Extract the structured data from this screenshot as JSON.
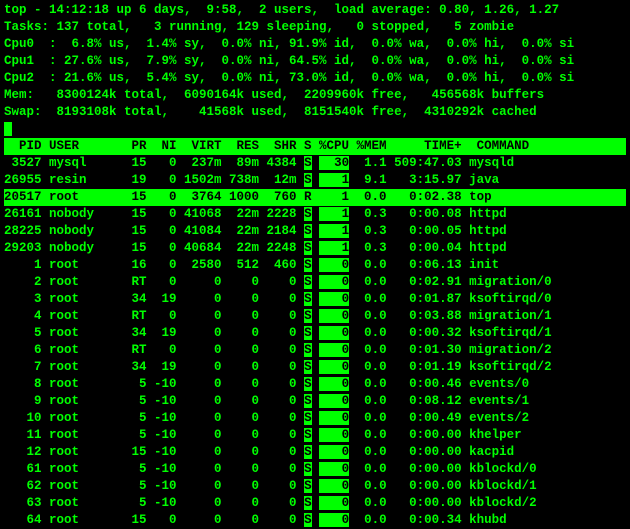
{
  "summary": {
    "l1": "top - 14:12:18 up 6 days,  9:58,  2 users,  load average: 0.80, 1.26, 1.27",
    "l2": "Tasks: 137 total,   3 running, 129 sleeping,   0 stopped,   5 zombie",
    "l3": "Cpu0  :  6.8% us,  1.4% sy,  0.0% ni, 91.9% id,  0.0% wa,  0.0% hi,  0.0% si",
    "l4": "Cpu1  : 27.6% us,  7.9% sy,  0.0% ni, 64.5% id,  0.0% wa,  0.0% hi,  0.0% si",
    "l5": "Cpu2  : 21.6% us,  5.4% sy,  0.0% ni, 73.0% id,  0.0% wa,  0.0% hi,  0.0% si",
    "l6": "Mem:   8300124k total,  6090164k used,  2209960k free,   456568k buffers",
    "l7": "Swap:  8193108k total,    41568k used,  8151540k free,  4310292k cached"
  },
  "columns": {
    "pid": "PID",
    "user": "USER",
    "pr": "PR",
    "ni": "NI",
    "virt": "VIRT",
    "res": "RES",
    "shr": "SHR",
    "s": "S",
    "cpu": "%CPU",
    "mem": "%MEM",
    "time": "TIME+",
    "command": "COMMAND"
  },
  "rows": [
    {
      "sel": false,
      "pid": "3527",
      "user": "mysql",
      "pr": "15",
      "ni": "0",
      "virt": "237m",
      "res": "89m",
      "shr": "4384",
      "s": "S",
      "cpu": "30",
      "mem": "1.1",
      "time": "509:47.03",
      "command": "mysqld"
    },
    {
      "sel": false,
      "pid": "26955",
      "user": "resin",
      "pr": "19",
      "ni": "0",
      "virt": "1502m",
      "res": "738m",
      "shr": "12m",
      "s": "S",
      "cpu": "1",
      "mem": "9.1",
      "time": "3:15.97",
      "command": "java"
    },
    {
      "sel": true,
      "pid": "20517",
      "user": "root",
      "pr": "15",
      "ni": "0",
      "virt": "3764",
      "res": "1000",
      "shr": "760",
      "s": "R",
      "cpu": "1",
      "mem": "0.0",
      "time": "0:02.38",
      "command": "top"
    },
    {
      "sel": false,
      "pid": "26161",
      "user": "nobody",
      "pr": "15",
      "ni": "0",
      "virt": "41068",
      "res": "22m",
      "shr": "2228",
      "s": "S",
      "cpu": "1",
      "mem": "0.3",
      "time": "0:00.08",
      "command": "httpd"
    },
    {
      "sel": false,
      "pid": "28225",
      "user": "nobody",
      "pr": "15",
      "ni": "0",
      "virt": "41084",
      "res": "22m",
      "shr": "2184",
      "s": "S",
      "cpu": "1",
      "mem": "0.3",
      "time": "0:00.05",
      "command": "httpd"
    },
    {
      "sel": false,
      "pid": "29203",
      "user": "nobody",
      "pr": "15",
      "ni": "0",
      "virt": "40684",
      "res": "22m",
      "shr": "2248",
      "s": "S",
      "cpu": "1",
      "mem": "0.3",
      "time": "0:00.04",
      "command": "httpd"
    },
    {
      "sel": false,
      "pid": "1",
      "user": "root",
      "pr": "16",
      "ni": "0",
      "virt": "2580",
      "res": "512",
      "shr": "460",
      "s": "S",
      "cpu": "0",
      "mem": "0.0",
      "time": "0:06.13",
      "command": "init"
    },
    {
      "sel": false,
      "pid": "2",
      "user": "root",
      "pr": "RT",
      "ni": "0",
      "virt": "0",
      "res": "0",
      "shr": "0",
      "s": "S",
      "cpu": "0",
      "mem": "0.0",
      "time": "0:02.91",
      "command": "migration/0"
    },
    {
      "sel": false,
      "pid": "3",
      "user": "root",
      "pr": "34",
      "ni": "19",
      "virt": "0",
      "res": "0",
      "shr": "0",
      "s": "S",
      "cpu": "0",
      "mem": "0.0",
      "time": "0:01.87",
      "command": "ksoftirqd/0"
    },
    {
      "sel": false,
      "pid": "4",
      "user": "root",
      "pr": "RT",
      "ni": "0",
      "virt": "0",
      "res": "0",
      "shr": "0",
      "s": "S",
      "cpu": "0",
      "mem": "0.0",
      "time": "0:03.88",
      "command": "migration/1"
    },
    {
      "sel": false,
      "pid": "5",
      "user": "root",
      "pr": "34",
      "ni": "19",
      "virt": "0",
      "res": "0",
      "shr": "0",
      "s": "S",
      "cpu": "0",
      "mem": "0.0",
      "time": "0:00.32",
      "command": "ksoftirqd/1"
    },
    {
      "sel": false,
      "pid": "6",
      "user": "root",
      "pr": "RT",
      "ni": "0",
      "virt": "0",
      "res": "0",
      "shr": "0",
      "s": "S",
      "cpu": "0",
      "mem": "0.0",
      "time": "0:01.30",
      "command": "migration/2"
    },
    {
      "sel": false,
      "pid": "7",
      "user": "root",
      "pr": "34",
      "ni": "19",
      "virt": "0",
      "res": "0",
      "shr": "0",
      "s": "S",
      "cpu": "0",
      "mem": "0.0",
      "time": "0:01.19",
      "command": "ksoftirqd/2"
    },
    {
      "sel": false,
      "pid": "8",
      "user": "root",
      "pr": "5",
      "ni": "-10",
      "virt": "0",
      "res": "0",
      "shr": "0",
      "s": "S",
      "cpu": "0",
      "mem": "0.0",
      "time": "0:00.46",
      "command": "events/0"
    },
    {
      "sel": false,
      "pid": "9",
      "user": "root",
      "pr": "5",
      "ni": "-10",
      "virt": "0",
      "res": "0",
      "shr": "0",
      "s": "S",
      "cpu": "0",
      "mem": "0.0",
      "time": "0:08.12",
      "command": "events/1"
    },
    {
      "sel": false,
      "pid": "10",
      "user": "root",
      "pr": "5",
      "ni": "-10",
      "virt": "0",
      "res": "0",
      "shr": "0",
      "s": "S",
      "cpu": "0",
      "mem": "0.0",
      "time": "0:00.49",
      "command": "events/2"
    },
    {
      "sel": false,
      "pid": "11",
      "user": "root",
      "pr": "5",
      "ni": "-10",
      "virt": "0",
      "res": "0",
      "shr": "0",
      "s": "S",
      "cpu": "0",
      "mem": "0.0",
      "time": "0:00.00",
      "command": "khelper"
    },
    {
      "sel": false,
      "pid": "12",
      "user": "root",
      "pr": "15",
      "ni": "-10",
      "virt": "0",
      "res": "0",
      "shr": "0",
      "s": "S",
      "cpu": "0",
      "mem": "0.0",
      "time": "0:00.00",
      "command": "kacpid"
    },
    {
      "sel": false,
      "pid": "61",
      "user": "root",
      "pr": "5",
      "ni": "-10",
      "virt": "0",
      "res": "0",
      "shr": "0",
      "s": "S",
      "cpu": "0",
      "mem": "0.0",
      "time": "0:00.00",
      "command": "kblockd/0"
    },
    {
      "sel": false,
      "pid": "62",
      "user": "root",
      "pr": "5",
      "ni": "-10",
      "virt": "0",
      "res": "0",
      "shr": "0",
      "s": "S",
      "cpu": "0",
      "mem": "0.0",
      "time": "0:00.00",
      "command": "kblockd/1"
    },
    {
      "sel": false,
      "pid": "63",
      "user": "root",
      "pr": "5",
      "ni": "-10",
      "virt": "0",
      "res": "0",
      "shr": "0",
      "s": "S",
      "cpu": "0",
      "mem": "0.0",
      "time": "0:00.00",
      "command": "kblockd/2"
    },
    {
      "sel": false,
      "pid": "64",
      "user": "root",
      "pr": "15",
      "ni": "0",
      "virt": "0",
      "res": "0",
      "shr": "0",
      "s": "S",
      "cpu": "0",
      "mem": "0.0",
      "time": "0:00.34",
      "command": "khubd"
    }
  ]
}
